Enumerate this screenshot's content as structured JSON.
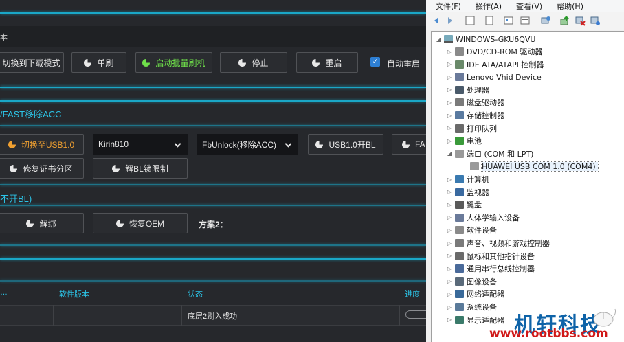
{
  "flash_tool": {
    "tab_label": "本",
    "buttons_row1": {
      "switch_download": "切换到下载模式",
      "single_flash": "单刷",
      "batch_flash": "启动批量刷机",
      "stop": "停止",
      "restart": "重启",
      "auto_restart_label": "自动重启",
      "auto_restart_checked": true
    },
    "section_fast": {
      "title": "/FAST移除ACC",
      "switch_usb": "切换至USB1.0",
      "chip_select": "Kirin810",
      "unlock_select": "FbUnlock(移除ACC)",
      "usb_open_bl": "USB1.0开BL",
      "fa_button": "FA",
      "repair_cert": "修复证书分区",
      "bl_unlock_limit": "解BL锁限制"
    },
    "section_nobl": {
      "title": "不开BL)",
      "unbind": "解绑",
      "restore_oem": "恢复OEM",
      "plan2_label": "方案2："
    },
    "table": {
      "headers": [
        "软件版本",
        "状态",
        "进度"
      ],
      "first_header_fragment": "…",
      "rows": [
        {
          "status": "底层2刷入成功"
        }
      ]
    },
    "colors": {
      "accent": "#1aa7c7",
      "orange": "#f0a030",
      "green": "#6fe04a"
    }
  },
  "device_manager": {
    "menu": [
      "文件(F)",
      "操作(A)",
      "查看(V)",
      "帮助(H)"
    ],
    "root": "WINDOWS-GKU6QVU",
    "nodes": [
      {
        "label": "DVD/CD-ROM 驱动器",
        "icon": "dvd-icon",
        "expanded": false
      },
      {
        "label": "IDE ATA/ATAPI 控制器",
        "icon": "ide-icon",
        "expanded": false
      },
      {
        "label": "Lenovo Vhid Device",
        "icon": "hid-icon",
        "expanded": false
      },
      {
        "label": "处理器",
        "icon": "cpu-icon",
        "expanded": false
      },
      {
        "label": "磁盘驱动器",
        "icon": "disk-icon",
        "expanded": false
      },
      {
        "label": "存储控制器",
        "icon": "storage-icon",
        "expanded": false
      },
      {
        "label": "打印队列",
        "icon": "printer-icon",
        "expanded": false
      },
      {
        "label": "电池",
        "icon": "battery-icon",
        "expanded": false
      },
      {
        "label": "端口 (COM 和 LPT)",
        "icon": "port-icon",
        "expanded": true
      },
      {
        "label": "计算机",
        "icon": "computer-icon",
        "expanded": false
      },
      {
        "label": "监视器",
        "icon": "monitor-icon",
        "expanded": false
      },
      {
        "label": "键盘",
        "icon": "keyboard-icon",
        "expanded": false
      },
      {
        "label": "人体学输入设备",
        "icon": "hid-icon",
        "expanded": false
      },
      {
        "label": "软件设备",
        "icon": "software-icon",
        "expanded": false
      },
      {
        "label": "声音、视频和游戏控制器",
        "icon": "sound-icon",
        "expanded": false
      },
      {
        "label": "鼠标和其他指针设备",
        "icon": "mouse-icon",
        "expanded": false
      },
      {
        "label": "通用串行总线控制器",
        "icon": "usb-icon",
        "expanded": false
      },
      {
        "label": "图像设备",
        "icon": "camera-icon",
        "expanded": false
      },
      {
        "label": "网络适配器",
        "icon": "network-icon",
        "expanded": false
      },
      {
        "label": "系统设备",
        "icon": "system-icon",
        "expanded": false
      },
      {
        "label": "显示适配器",
        "icon": "display-icon",
        "expanded": false
      }
    ],
    "port_child": "HUAWEI USB COM 1.0 (COM4)"
  },
  "watermark": {
    "title": "机轩科技",
    "url": "www.rootbbs.com"
  }
}
